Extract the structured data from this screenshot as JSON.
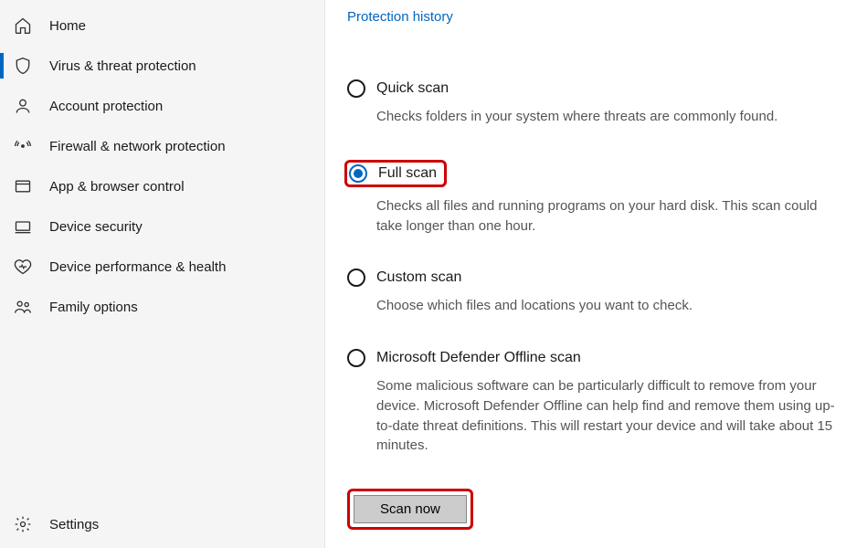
{
  "sidebar": {
    "items": [
      {
        "label": "Home"
      },
      {
        "label": "Virus & threat protection"
      },
      {
        "label": "Account protection"
      },
      {
        "label": "Firewall & network protection"
      },
      {
        "label": "App & browser control"
      },
      {
        "label": "Device security"
      },
      {
        "label": "Device performance & health"
      },
      {
        "label": "Family options"
      }
    ],
    "settings_label": "Settings"
  },
  "main": {
    "history_link": "Protection history",
    "options": [
      {
        "label": "Quick scan",
        "desc": "Checks folders in your system where threats are commonly found."
      },
      {
        "label": "Full scan",
        "desc": "Checks all files and running programs on your hard disk. This scan could take longer than one hour."
      },
      {
        "label": "Custom scan",
        "desc": "Choose which files and locations you want to check."
      },
      {
        "label": "Microsoft Defender Offline scan",
        "desc": "Some malicious software can be particularly difficult to remove from your device. Microsoft Defender Offline can help find and remove them using up-to-date threat definitions. This will restart your device and will take about 15 minutes."
      }
    ],
    "scan_button": "Scan now"
  }
}
